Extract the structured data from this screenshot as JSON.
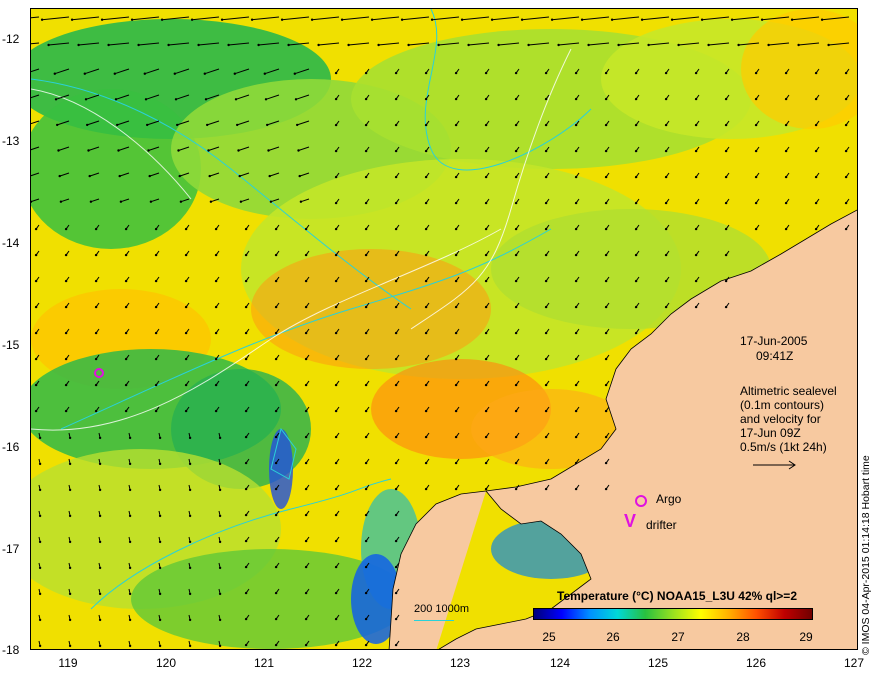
{
  "map": {
    "lat_ticks": [
      "-12",
      "-13",
      "-14",
      "-15",
      "-16",
      "-17",
      "-18"
    ],
    "lon_ticks": [
      "119",
      "120",
      "121",
      "122",
      "123",
      "124",
      "125",
      "126",
      "127"
    ],
    "lat_range": [
      -18,
      -11.85
    ],
    "lon_range": [
      118.6,
      127.0
    ]
  },
  "annotations": {
    "date": "17-Jun-2005",
    "time": "09:41Z",
    "altimetry_lines": [
      "Altimetric sealevel",
      "(0.1m contours)",
      "and velocity for",
      "17-Jun 09Z",
      "0.5m/s (1kt 24h)"
    ],
    "credit": "© IMOS 04-Apr-2015 01:14:18 Hobart time",
    "argo_label": "Argo",
    "drifter_label": "drifter",
    "drifter_symbol": "V",
    "contour_key": "200  1000m"
  },
  "legend": {
    "title": "Temperature (°C) NOAA15_L3U 42% ql>=2",
    "ticks": [
      "25",
      "26",
      "27",
      "28",
      "29"
    ],
    "colors": [
      "#00007a",
      "#0000ff",
      "#0090ff",
      "#00d8d8",
      "#28c040",
      "#98e020",
      "#ffff00",
      "#ffb000",
      "#ff5000",
      "#c00000",
      "#700000"
    ]
  },
  "colors": {
    "land": "#f7c9a0",
    "contour": "#2ad1d8",
    "marker": "#e011e0"
  }
}
